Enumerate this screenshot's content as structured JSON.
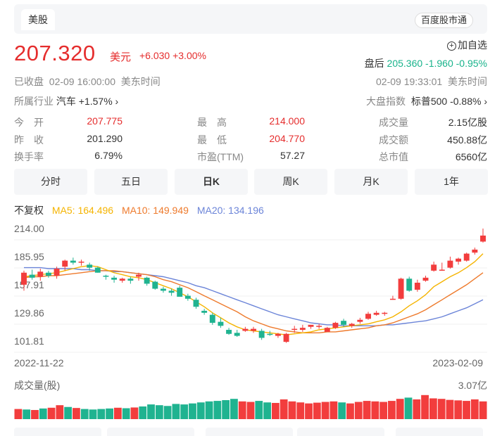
{
  "header": {
    "tab_label": "美股",
    "market_link": "百度股市通"
  },
  "quote": {
    "price": "207.320",
    "currency": "美元",
    "change": "+6.030 +3.00%",
    "watch_label": "加自选",
    "after_hours_label": "盘后",
    "after_hours_value": "205.360 -1.960 -0.95%",
    "status": "已收盘",
    "close_time": "02-09 16:00:00",
    "close_tz": "美东时间",
    "after_time": "02-09 19:33:01",
    "after_tz": "美东时间"
  },
  "industry": {
    "label": "所属行业",
    "name": "汽车",
    "change": "+1.57%",
    "index_label": "大盘指数",
    "index_name": "标普500",
    "index_change": "-0.88%"
  },
  "stats": [
    {
      "label": "今　开",
      "value": "207.775",
      "tone": "red"
    },
    {
      "label": "最　高",
      "value": "214.000",
      "tone": "red"
    },
    {
      "label": "成交量",
      "value": "2.15亿股",
      "tone": "dark"
    },
    {
      "label": "昨　收",
      "value": "201.290",
      "tone": "dark"
    },
    {
      "label": "最　低",
      "value": "204.770",
      "tone": "red"
    },
    {
      "label": "成交额",
      "value": "450.88亿",
      "tone": "dark"
    },
    {
      "label": "换手率",
      "value": "6.79%",
      "tone": "dark"
    },
    {
      "label": "市盈(TTM)",
      "value": "57.27",
      "tone": "dark"
    },
    {
      "label": "总市值",
      "value": "6560亿",
      "tone": "dark"
    }
  ],
  "periods": [
    "分时",
    "五日",
    "日K",
    "周K",
    "月K",
    "1年"
  ],
  "active_period": "日K",
  "ma": {
    "adjust": "不复权",
    "ma5": "MA5: 164.496",
    "ma10": "MA10: 149.949",
    "ma20": "MA20: 134.196",
    "ma5_color": "#f5b400",
    "ma10_color": "#ee7a2c",
    "ma20_color": "#6b84d8"
  },
  "colors": {
    "up": "#f23d3d",
    "down": "#1fb390"
  },
  "chart_data": {
    "type": "candlestick",
    "y_ticks": [
      "214.00",
      "185.95",
      "157.91",
      "129.86",
      "101.81"
    ],
    "ylim": [
      101.81,
      214.0
    ],
    "x_start_label": "2022-11-22",
    "x_end_label": "2023-02-09",
    "candles": [
      {
        "o": 158,
        "h": 172,
        "l": 152,
        "c": 170
      },
      {
        "o": 168,
        "h": 173,
        "l": 163,
        "c": 165
      },
      {
        "o": 166,
        "h": 174,
        "l": 162,
        "c": 171
      },
      {
        "o": 170,
        "h": 172,
        "l": 165,
        "c": 167
      },
      {
        "o": 167,
        "h": 176,
        "l": 164,
        "c": 174
      },
      {
        "o": 176,
        "h": 183,
        "l": 172,
        "c": 182
      },
      {
        "o": 182,
        "h": 185,
        "l": 178,
        "c": 180
      },
      {
        "o": 180,
        "h": 183,
        "l": 177,
        "c": 181
      },
      {
        "o": 178,
        "h": 180,
        "l": 172,
        "c": 175
      },
      {
        "o": 175,
        "h": 176,
        "l": 170,
        "c": 170
      },
      {
        "o": 167,
        "h": 168,
        "l": 163,
        "c": 166
      },
      {
        "o": 165,
        "h": 167,
        "l": 160,
        "c": 163
      },
      {
        "o": 162,
        "h": 165,
        "l": 160,
        "c": 164
      },
      {
        "o": 164,
        "h": 166,
        "l": 159,
        "c": 162
      },
      {
        "o": 166,
        "h": 170,
        "l": 162,
        "c": 168
      },
      {
        "o": 165,
        "h": 166,
        "l": 157,
        "c": 159
      },
      {
        "o": 161,
        "h": 162,
        "l": 153,
        "c": 154
      },
      {
        "o": 154,
        "h": 156,
        "l": 150,
        "c": 152
      },
      {
        "o": 152,
        "h": 154,
        "l": 147,
        "c": 150
      },
      {
        "o": 155,
        "h": 157,
        "l": 146,
        "c": 146
      },
      {
        "o": 147,
        "h": 149,
        "l": 142,
        "c": 144
      },
      {
        "o": 143,
        "h": 145,
        "l": 134,
        "c": 136
      },
      {
        "o": 132,
        "h": 134,
        "l": 128,
        "c": 130
      },
      {
        "o": 128,
        "h": 130,
        "l": 118,
        "c": 120
      },
      {
        "o": 121,
        "h": 125,
        "l": 115,
        "c": 117
      },
      {
        "o": 113,
        "h": 115,
        "l": 108,
        "c": 109
      },
      {
        "o": 110,
        "h": 113,
        "l": 106,
        "c": 107
      },
      {
        "o": 112,
        "h": 116,
        "l": 111,
        "c": 114
      },
      {
        "o": 112,
        "h": 116,
        "l": 110,
        "c": 114
      },
      {
        "o": 112,
        "h": 114,
        "l": 103,
        "c": 105
      },
      {
        "o": 109,
        "h": 112,
        "l": 107,
        "c": 108
      },
      {
        "o": 107,
        "h": 110,
        "l": 105,
        "c": 109
      },
      {
        "o": 101,
        "h": 110,
        "l": 100,
        "c": 109
      },
      {
        "o": 114,
        "h": 117,
        "l": 110,
        "c": 114
      },
      {
        "o": 113,
        "h": 118,
        "l": 111,
        "c": 115
      },
      {
        "o": 116,
        "h": 118,
        "l": 114,
        "c": 118
      },
      {
        "o": 117,
        "h": 119,
        "l": 114,
        "c": 117
      },
      {
        "o": 111,
        "h": 116,
        "l": 111,
        "c": 115
      },
      {
        "o": 115,
        "h": 121,
        "l": 114,
        "c": 120
      },
      {
        "o": 122,
        "h": 124,
        "l": 116,
        "c": 118
      },
      {
        "o": 117,
        "h": 120,
        "l": 115,
        "c": 119
      },
      {
        "o": 121,
        "h": 125,
        "l": 119,
        "c": 123
      },
      {
        "o": 124,
        "h": 131,
        "l": 123,
        "c": 129
      },
      {
        "o": 128,
        "h": 132,
        "l": 127,
        "c": 130
      },
      {
        "o": 129,
        "h": 131,
        "l": 127,
        "c": 130
      },
      {
        "o": 144,
        "h": 147,
        "l": 143,
        "c": 144
      },
      {
        "o": 144,
        "h": 165,
        "l": 143,
        "c": 164
      },
      {
        "o": 164,
        "h": 166,
        "l": 151,
        "c": 152
      },
      {
        "o": 153,
        "h": 163,
        "l": 151,
        "c": 160
      },
      {
        "o": 162,
        "h": 167,
        "l": 161,
        "c": 165
      },
      {
        "o": 172,
        "h": 181,
        "l": 171,
        "c": 178
      },
      {
        "o": 173,
        "h": 180,
        "l": 172,
        "c": 173
      },
      {
        "o": 175,
        "h": 186,
        "l": 174,
        "c": 182
      },
      {
        "o": 181,
        "h": 185,
        "l": 178,
        "c": 184
      },
      {
        "o": 182,
        "h": 190,
        "l": 181,
        "c": 189
      },
      {
        "o": 190,
        "h": 195,
        "l": 188,
        "c": 193
      },
      {
        "o": 201,
        "h": 214,
        "l": 200,
        "c": 207
      }
    ],
    "ma5": [
      166,
      167,
      168,
      169,
      170,
      172,
      174,
      176,
      177,
      176,
      173,
      170,
      168,
      166,
      165,
      163,
      160,
      157,
      154,
      150,
      146,
      141,
      136,
      130,
      125,
      120,
      116,
      113,
      112,
      111,
      110,
      109,
      108,
      109,
      110,
      111,
      113,
      114,
      115,
      116,
      117,
      118,
      119,
      121,
      123,
      126,
      131,
      137,
      142,
      148,
      156,
      161,
      166,
      170,
      175,
      181,
      189
    ],
    "ma10": [
      165,
      166,
      166,
      167,
      167,
      168,
      169,
      170,
      171,
      172,
      172,
      172,
      171,
      170,
      169,
      168,
      166,
      163,
      161,
      158,
      155,
      151,
      147,
      143,
      139,
      135,
      131,
      126,
      122,
      119,
      116,
      114,
      112,
      111,
      110,
      110,
      110,
      111,
      111,
      112,
      113,
      114,
      115,
      117,
      118,
      120,
      123,
      126,
      129,
      133,
      138,
      143,
      148,
      153,
      158,
      164,
      170
    ],
    "ma20": [
      175,
      175,
      175,
      174,
      174,
      174,
      174,
      173,
      173,
      172,
      172,
      171,
      171,
      170,
      169,
      168,
      167,
      166,
      164,
      162,
      160,
      157,
      155,
      152,
      149,
      146,
      143,
      140,
      137,
      134,
      131,
      128,
      126,
      124,
      122,
      120,
      119,
      118,
      118,
      117,
      117,
      117,
      117,
      117,
      118,
      118,
      119,
      120,
      121,
      122,
      124,
      126,
      129,
      132,
      135,
      139,
      143
    ],
    "volume_title": "成交量(股)",
    "volume_max": "3.07亿",
    "volumes": [
      0.4,
      0.38,
      0.36,
      0.42,
      0.45,
      0.55,
      0.48,
      0.44,
      0.4,
      0.38,
      0.4,
      0.42,
      0.45,
      0.43,
      0.46,
      0.5,
      0.58,
      0.55,
      0.52,
      0.6,
      0.58,
      0.62,
      0.66,
      0.7,
      0.72,
      0.75,
      0.8,
      0.7,
      0.68,
      0.72,
      0.66,
      0.64,
      0.78,
      0.7,
      0.66,
      0.62,
      0.65,
      0.68,
      0.7,
      0.66,
      0.62,
      0.68,
      0.72,
      0.7,
      0.68,
      0.72,
      0.8,
      0.85,
      0.78,
      0.95,
      0.82,
      0.8,
      0.76,
      0.74,
      0.72,
      0.78,
      0.7
    ]
  }
}
